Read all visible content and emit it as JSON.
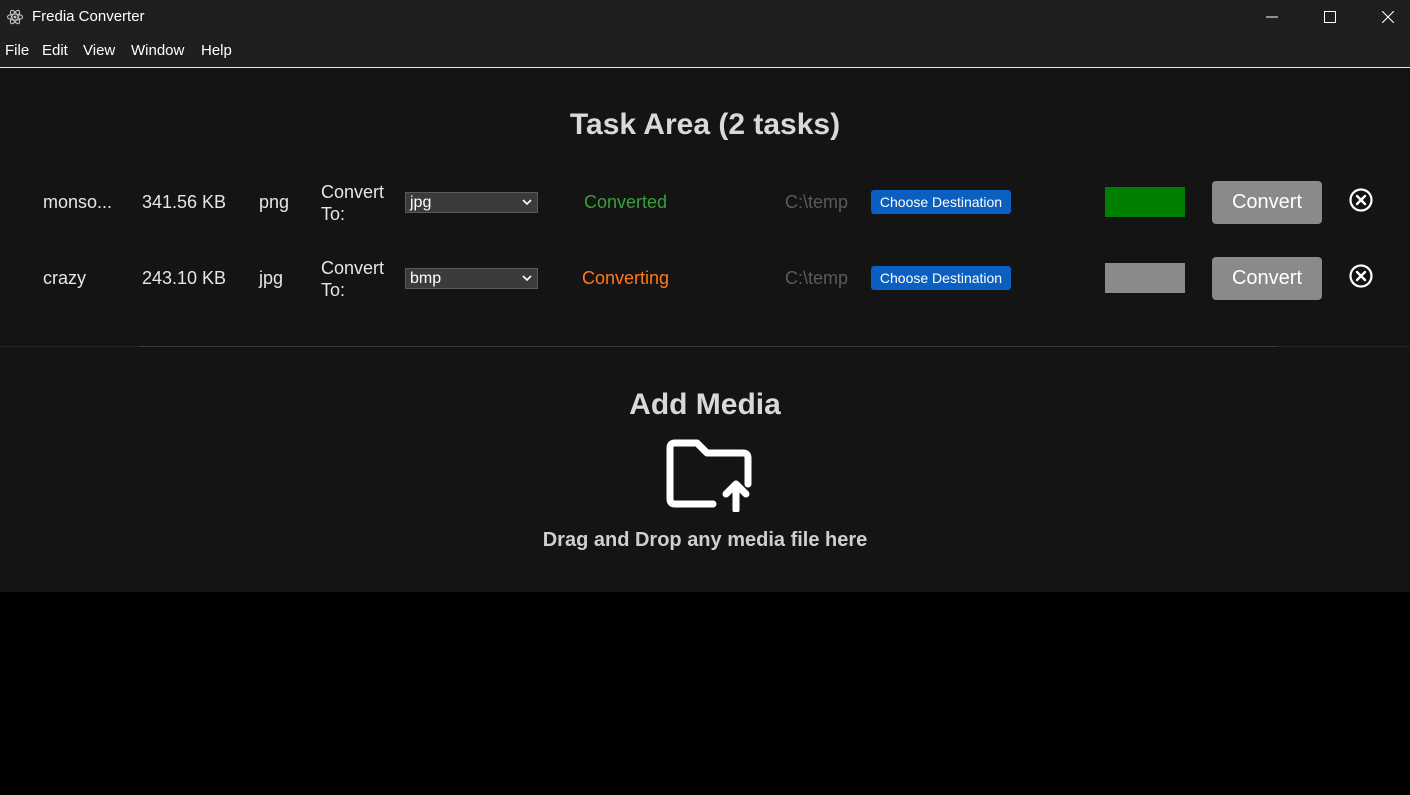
{
  "window": {
    "title": "Fredia Converter",
    "icon": "electron-atom-icon"
  },
  "menu": [
    "File",
    "Edit",
    "View",
    "Window",
    "Help"
  ],
  "task_area": {
    "title": "Task Area (2 tasks)",
    "tasks": [
      {
        "name": "monso...",
        "size": "341.56 KB",
        "format": "png",
        "convert_label": "Convert To:",
        "target": "jpg",
        "status": "Converted",
        "status_color": "#3c9e3c",
        "destination": "C:\\temp",
        "choose_label": "Choose Destination",
        "progress_color": "#008000",
        "convert_label_btn": "Convert"
      },
      {
        "name": "crazy",
        "size": "243.10 KB",
        "format": "jpg",
        "convert_label": "Convert To:",
        "target": "bmp",
        "status": "Converting",
        "status_color": "#ff7a1a",
        "destination": "C:\\temp",
        "choose_label": "Choose Destination",
        "progress_color": "#8a8a8a",
        "convert_label_btn": "Convert"
      }
    ]
  },
  "add_media": {
    "title": "Add Media",
    "icon": "folder-upload-icon",
    "hint": "Drag and Drop any media file here"
  },
  "colors": {
    "accent_blue": "#0a5fc0",
    "background": "#141414",
    "titlebar": "#1f1f1f"
  }
}
